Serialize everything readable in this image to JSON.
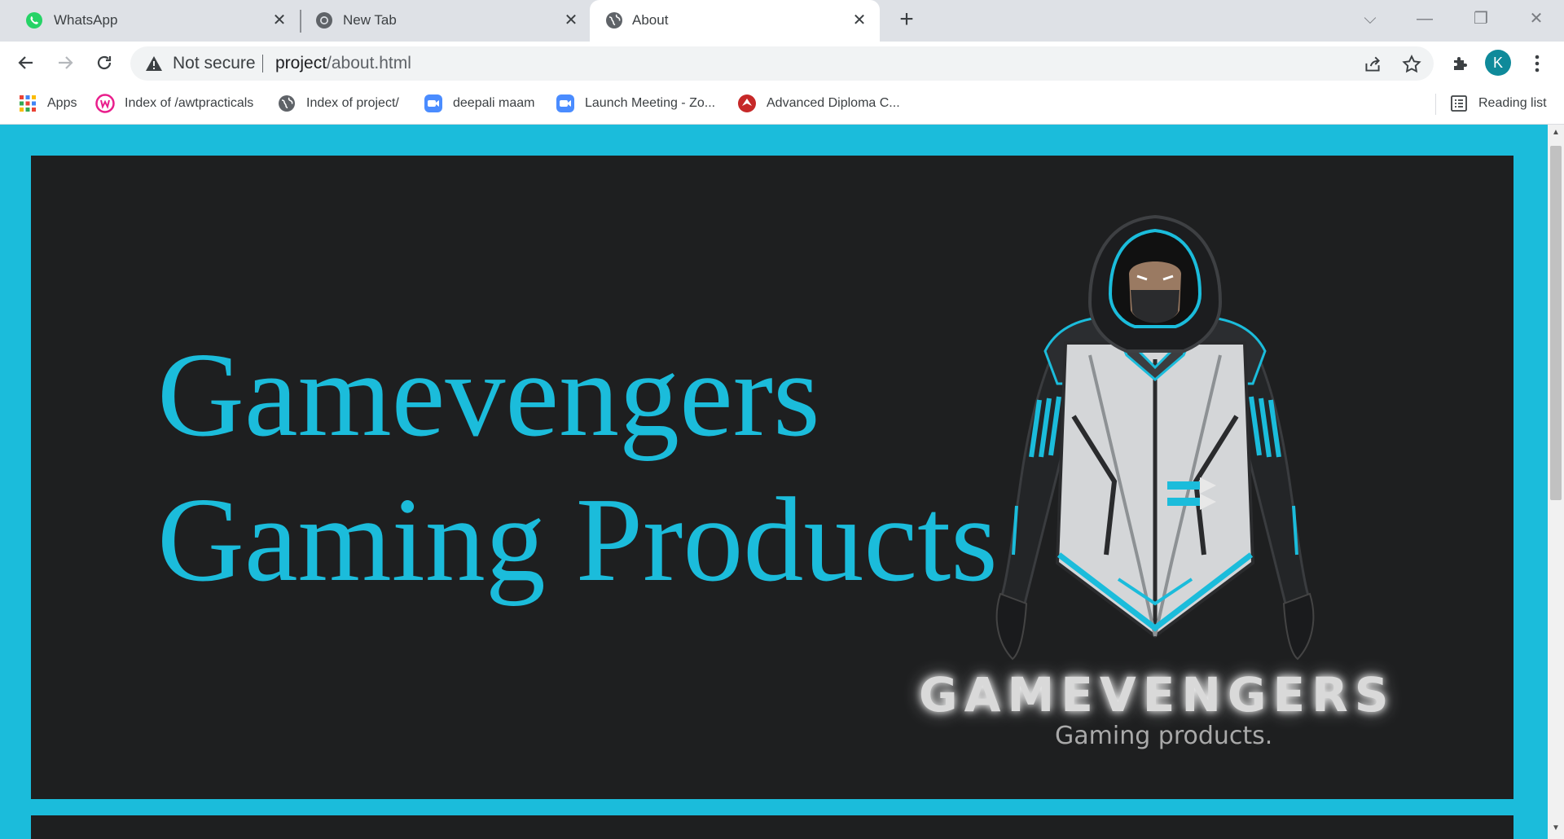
{
  "browser": {
    "tabs": [
      {
        "label": "WhatsApp",
        "icon": "whatsapp-icon",
        "active": false
      },
      {
        "label": "New Tab",
        "icon": "chrome-icon",
        "active": false
      },
      {
        "label": "About",
        "icon": "globe-icon",
        "active": true
      }
    ],
    "new_tab_symbol": "+",
    "address": {
      "security_label": "Not secure",
      "url_host": "project",
      "url_path": "/about.html"
    },
    "profile_initial": "K",
    "bookmarks": [
      {
        "label": "Apps",
        "icon": "apps-grid-icon"
      },
      {
        "label": "Index of /awtpracticals",
        "icon": "wamp-icon"
      },
      {
        "label": "Index of project/",
        "icon": "globe-icon"
      },
      {
        "label": "deepali maam",
        "icon": "zoom-icon"
      },
      {
        "label": "Launch Meeting - Zo...",
        "icon": "zoom-icon"
      },
      {
        "label": "Advanced Diploma C...",
        "icon": "site-logo-icon"
      }
    ],
    "reading_list_label": "Reading list"
  },
  "page": {
    "hero_title_line1": "Gamevengers",
    "hero_title_line2": "Gaming Products",
    "brand_name": "GAMEVENGERS",
    "brand_tagline": "Gaming products."
  },
  "colors": {
    "accent": "#1bbcdb",
    "hero_background": "#1e1f20",
    "tabstrip": "#dee1e6"
  }
}
